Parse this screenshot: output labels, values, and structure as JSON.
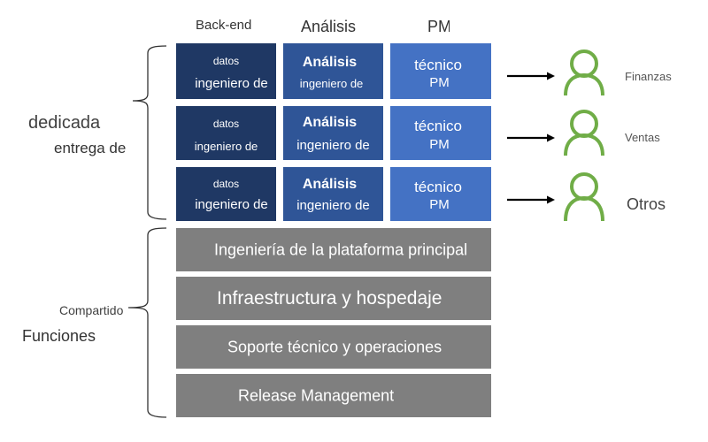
{
  "column_headers": [
    "Back-end",
    "Análisis",
    "PM"
  ],
  "dedicated_rows": [
    {
      "cells": [
        {
          "line1": "datos",
          "line2": "ingeniero de"
        },
        {
          "line1": "Análisis",
          "line2": "ingeniero de"
        },
        {
          "line1": "técnico",
          "line2": "PM"
        }
      ],
      "stakeholder": "Finanzas"
    },
    {
      "cells": [
        {
          "line1": "datos",
          "line2": "ingeniero de"
        },
        {
          "line1": "Análisis",
          "line2": "ingeniero de"
        },
        {
          "line1": "técnico",
          "line2": "PM"
        }
      ],
      "stakeholder": "Ventas"
    },
    {
      "cells": [
        {
          "line1": "datos",
          "line2": "ingeniero de"
        },
        {
          "line1": "Análisis",
          "line2": "ingeniero de"
        },
        {
          "line1": "técnico",
          "line2": "PM"
        }
      ],
      "stakeholder": "Otros"
    }
  ],
  "dedicated_group": {
    "line1": "dedicada",
    "line2": "entrega de"
  },
  "shared_group": {
    "line1": "Compartido",
    "line2": "Funciones"
  },
  "shared_functions": [
    "Ingeniería de la plataforma principal",
    "Infraestructura y hospedaje",
    "Soporte técnico y operaciones",
    "Release Management"
  ],
  "colors": {
    "backend": "#1f3864",
    "analytics": "#2f5597",
    "pm": "#4472c4",
    "shared": "#7f7f7f",
    "person_icon": "#70ad47",
    "arrow": "#000000"
  }
}
